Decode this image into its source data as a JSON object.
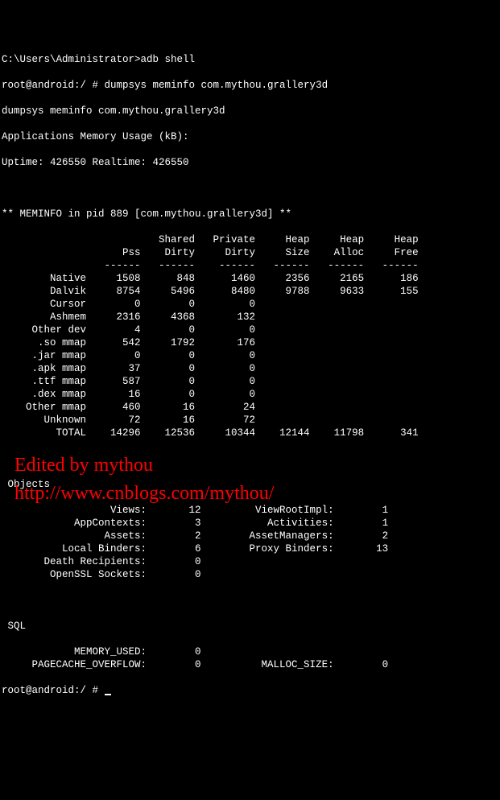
{
  "header": {
    "line1": "C:\\Users\\Administrator>adb shell",
    "line2": "root@android:/ # dumpsys meminfo com.mythou.grallery3d",
    "line3": "dumpsys meminfo com.mythou.grallery3d",
    "line4": "Applications Memory Usage (kB):",
    "line5": "Uptime: 426550 Realtime: 426550"
  },
  "meminfo_title": "** MEMINFO in pid 889 [com.mythou.grallery3d] **",
  "table": {
    "hdr1": {
      "c1": "",
      "c2": "Shared",
      "c3": "Private",
      "c4": "Heap",
      "c5": "Heap",
      "c6": "Heap"
    },
    "hdr2": {
      "c0": "Pss",
      "c1": "Dirty",
      "c2": "Dirty",
      "c3": "Size",
      "c4": "Alloc",
      "c5": "Free"
    },
    "sep": "------",
    "rows": [
      {
        "label": "Native",
        "pss": "1508",
        "sd": "848",
        "pd": "1460",
        "hs": "2356",
        "ha": "2165",
        "hf": "186"
      },
      {
        "label": "Dalvik",
        "pss": "8754",
        "sd": "5496",
        "pd": "8480",
        "hs": "9788",
        "ha": "9633",
        "hf": "155"
      },
      {
        "label": "Cursor",
        "pss": "0",
        "sd": "0",
        "pd": "0",
        "hs": "",
        "ha": "",
        "hf": ""
      },
      {
        "label": "Ashmem",
        "pss": "2316",
        "sd": "4368",
        "pd": "132",
        "hs": "",
        "ha": "",
        "hf": ""
      },
      {
        "label": "Other dev",
        "pss": "4",
        "sd": "0",
        "pd": "0",
        "hs": "",
        "ha": "",
        "hf": ""
      },
      {
        "label": ".so mmap",
        "pss": "542",
        "sd": "1792",
        "pd": "176",
        "hs": "",
        "ha": "",
        "hf": ""
      },
      {
        "label": ".jar mmap",
        "pss": "0",
        "sd": "0",
        "pd": "0",
        "hs": "",
        "ha": "",
        "hf": ""
      },
      {
        "label": ".apk mmap",
        "pss": "37",
        "sd": "0",
        "pd": "0",
        "hs": "",
        "ha": "",
        "hf": ""
      },
      {
        "label": ".ttf mmap",
        "pss": "587",
        "sd": "0",
        "pd": "0",
        "hs": "",
        "ha": "",
        "hf": ""
      },
      {
        "label": ".dex mmap",
        "pss": "16",
        "sd": "0",
        "pd": "0",
        "hs": "",
        "ha": "",
        "hf": ""
      },
      {
        "label": "Other mmap",
        "pss": "460",
        "sd": "16",
        "pd": "24",
        "hs": "",
        "ha": "",
        "hf": ""
      },
      {
        "label": "Unknown",
        "pss": "72",
        "sd": "16",
        "pd": "72",
        "hs": "",
        "ha": "",
        "hf": ""
      },
      {
        "label": "TOTAL",
        "pss": "14296",
        "sd": "12536",
        "pd": "10344",
        "hs": "12144",
        "ha": "11798",
        "hf": "341"
      }
    ]
  },
  "objects": {
    "title": " Objects",
    "rows": [
      {
        "l1": "Views:",
        "v1": "12",
        "l2": "ViewRootImpl:",
        "v2": "1"
      },
      {
        "l1": "AppContexts:",
        "v1": "3",
        "l2": "Activities:",
        "v2": "1"
      },
      {
        "l1": "Assets:",
        "v1": "2",
        "l2": "AssetManagers:",
        "v2": "2"
      },
      {
        "l1": "Local Binders:",
        "v1": "6",
        "l2": "Proxy Binders:",
        "v2": "13"
      },
      {
        "l1": "Death Recipients:",
        "v1": "0",
        "l2": "",
        "v2": ""
      },
      {
        "l1": "OpenSSL Sockets:",
        "v1": "0",
        "l2": "",
        "v2": ""
      }
    ]
  },
  "sql": {
    "title": " SQL",
    "rows": [
      {
        "l1": "MEMORY_USED:",
        "v1": "0",
        "l2": "",
        "v2": ""
      },
      {
        "l1": "PAGECACHE_OVERFLOW:",
        "v1": "0",
        "l2": "MALLOC_SIZE:",
        "v2": "0"
      }
    ]
  },
  "prompt": "root@android:/ # ",
  "watermark": {
    "line1": "Edited by mythou",
    "line2": "http://www.cnblogs.com/mythou/"
  }
}
